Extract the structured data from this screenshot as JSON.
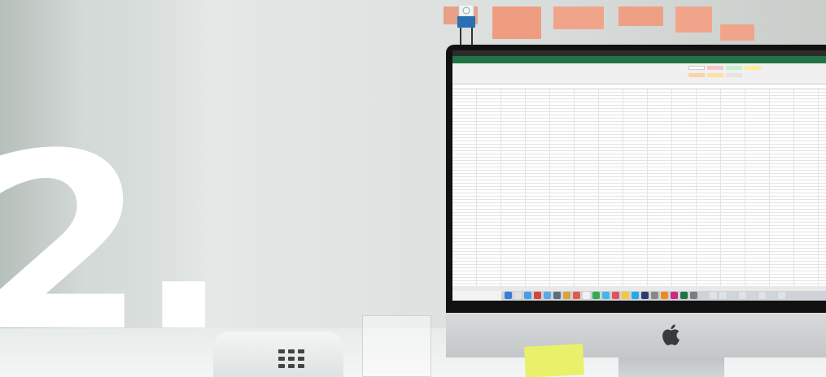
{
  "scene": {
    "big_number": "2.",
    "wall_color": "#d9dedb",
    "post_it_colors": [
      "#e8a087",
      "#ee9d80",
      "#f0a58a"
    ],
    "desk_note_color": "#e9f06a"
  },
  "imac": {
    "brand_icon": "apple-logo-icon",
    "screen_app": "spreadsheet",
    "accent_color": "#217346"
  }
}
